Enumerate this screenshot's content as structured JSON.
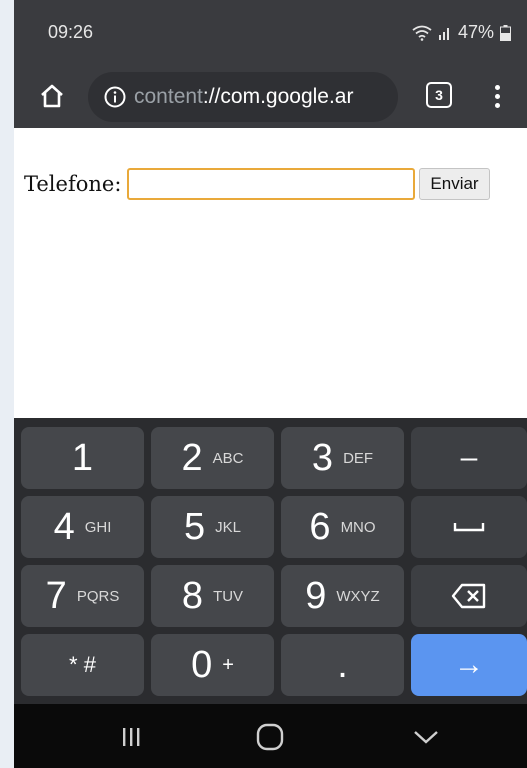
{
  "status": {
    "time": "09:26",
    "battery": "47%",
    "icons": [
      "wifi-icon",
      "signal-icon",
      "battery-icon"
    ]
  },
  "browser": {
    "url_scheme": "content",
    "url_rest": "://com.google.ar",
    "tab_count": "3",
    "icons": [
      "home-icon",
      "info-icon",
      "tabs-icon",
      "more-vert-icon"
    ]
  },
  "form": {
    "label": "Telefone:",
    "input_value": "",
    "button_label": "Enviar"
  },
  "keyboard": {
    "row1": [
      {
        "num": "1",
        "sub": ""
      },
      {
        "num": "2",
        "sub": "ABC"
      },
      {
        "num": "3",
        "sub": "DEF"
      },
      {
        "num": "–",
        "sub": ""
      }
    ],
    "row2": [
      {
        "num": "4",
        "sub": "GHI"
      },
      {
        "num": "5",
        "sub": "JKL"
      },
      {
        "num": "6",
        "sub": "MNO"
      },
      {
        "num": "",
        "sub": ""
      }
    ],
    "row3": [
      {
        "num": "7",
        "sub": "PQRS"
      },
      {
        "num": "8",
        "sub": "TUV"
      },
      {
        "num": "9",
        "sub": "WXYZ"
      },
      {
        "num": "",
        "sub": ""
      }
    ],
    "row4": [
      {
        "num": "* #",
        "sub": ""
      },
      {
        "num": "0",
        "sub": "+"
      },
      {
        "num": ".",
        "sub": ""
      },
      {
        "num": "→",
        "sub": ""
      }
    ]
  },
  "colors": {
    "toolbar": "#3a3b3f",
    "input_focus": "#e9a93a",
    "enter_key": "#5b95f0",
    "key": "#45474b"
  }
}
